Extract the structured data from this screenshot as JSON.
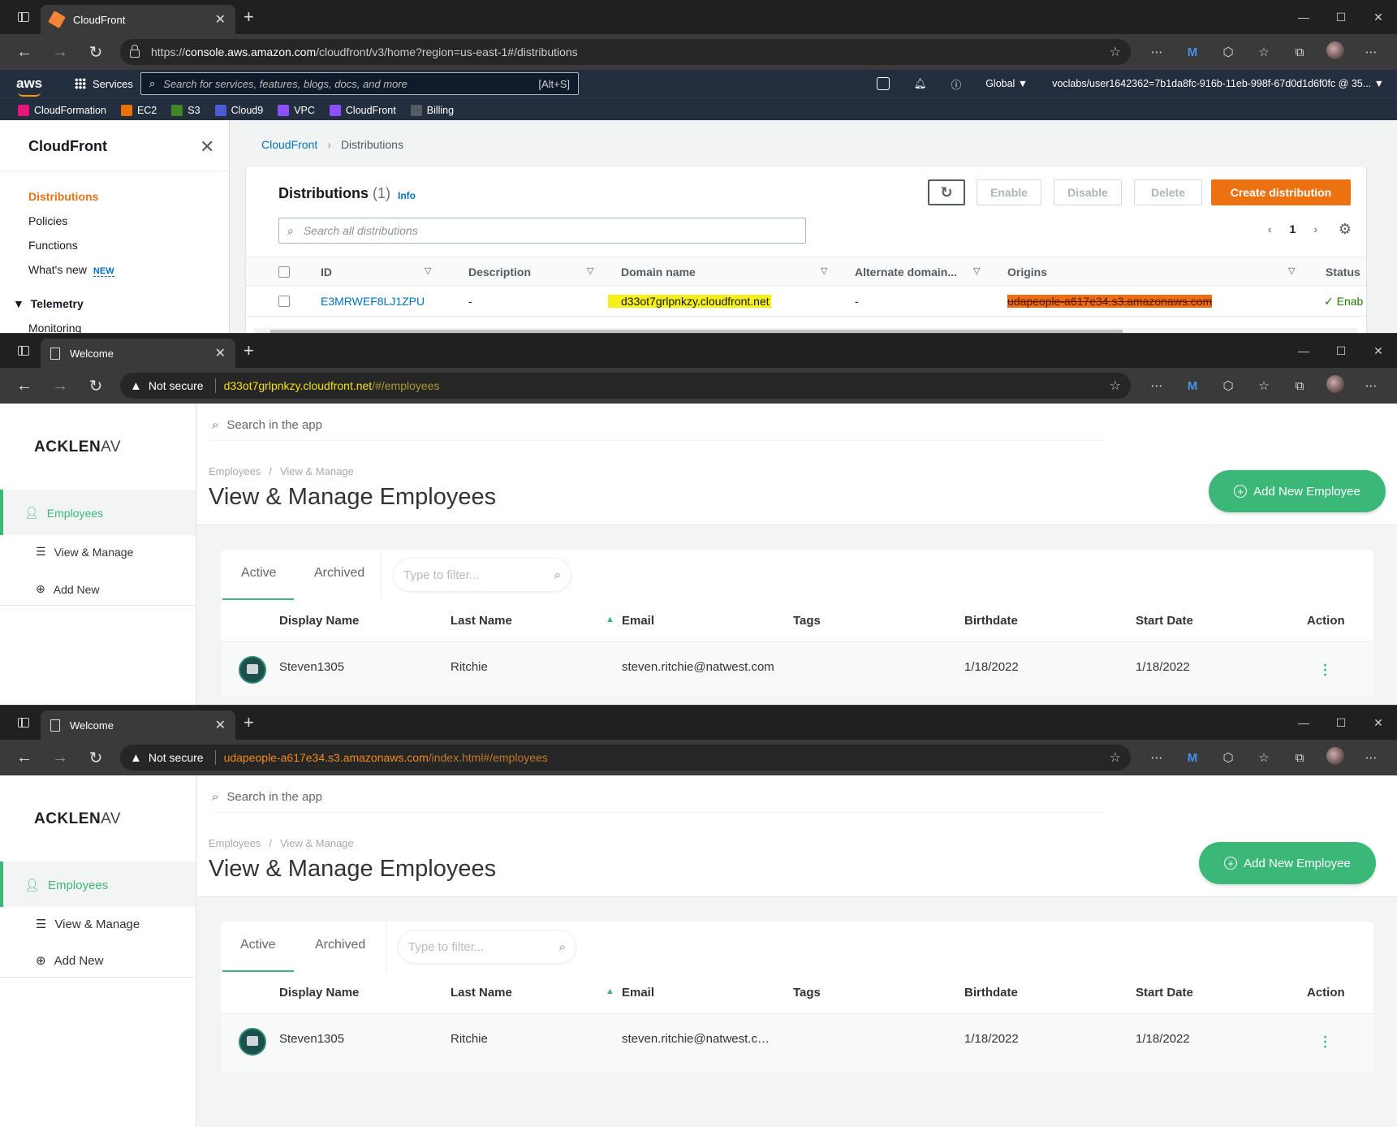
{
  "w1": {
    "tab_title": "CloudFront",
    "url_prefix": "https://",
    "url_host": "console.aws.amazon.com",
    "url_path": "/cloudfront/v3/home?region=us-east-1#/distributions",
    "aws": {
      "logo": "aws",
      "services": "Services",
      "search_placeholder": "Search for services, features, blogs, docs, and more",
      "shortcut": "[Alt+S]",
      "region": "Global ▼",
      "account": "voclabs/user1642362=7b1da8fc-916b-11eb-998f-67d0d1d6f0fc @ 35... ▼"
    },
    "favorites": [
      {
        "label": "CloudFormation",
        "color": "#e7157b"
      },
      {
        "label": "EC2",
        "color": "#ed7100"
      },
      {
        "label": "S3",
        "color": "#3f8624"
      },
      {
        "label": "Cloud9",
        "color": "#4d5bd9"
      },
      {
        "label": "VPC",
        "color": "#8c4fff"
      },
      {
        "label": "CloudFront",
        "color": "#8c4fff"
      },
      {
        "label": "Billing",
        "color": "#545b64"
      }
    ],
    "sidebar": {
      "title": "CloudFront",
      "items": [
        "Distributions",
        "Policies",
        "Functions",
        "What's new"
      ],
      "new_badge": "NEW",
      "telemetry": "Telemetry",
      "monitoring": "Monitoring"
    },
    "breadcrumb": [
      "CloudFront",
      "Distributions"
    ],
    "panel": {
      "title": "Distributions",
      "count": "(1)",
      "info": "Info",
      "buttons": {
        "enable": "Enable",
        "disable": "Disable",
        "delete": "Delete",
        "create": "Create distribution"
      },
      "search_placeholder": "Search all distributions",
      "page": "1",
      "columns": [
        "ID",
        "Description",
        "Domain name",
        "Alternate domain...",
        "Origins",
        "Status"
      ],
      "row": {
        "id": "E3MRWEF8LJ1ZPU",
        "description": "-",
        "domain": "d33ot7grlpnkzy.cloudfront.net",
        "alternate": "-",
        "origin": "udapeople-a617e34.s3.amazonaws.com",
        "status": "Enab"
      }
    }
  },
  "w2": {
    "tab_title": "Welcome",
    "not_secure": "Not secure",
    "url_host": "d33ot7grlpnkzy.cloudfront.net",
    "url_path": "/#/employees"
  },
  "w3": {
    "tab_title": "Welcome",
    "not_secure": "Not secure",
    "url_host": "udapeople-a617e34.s3.amazonaws.com",
    "url_path": "/index.html#/employees"
  },
  "app": {
    "logo_main": "ACKLEN",
    "logo_tail": "AV",
    "search_placeholder": "Search in the app",
    "nav": {
      "employees": "Employees",
      "view_manage": "View & Manage",
      "add_new": "Add New"
    },
    "breadcrumb": [
      "Employees",
      "View & Manage"
    ],
    "title": "View & Manage Employees",
    "add_button": "Add New Employee",
    "tabs": [
      "Active",
      "Archived"
    ],
    "filter_placeholder": "Type to filter...",
    "columns": [
      "Display Name",
      "Last Name",
      "Email",
      "Tags",
      "Birthdate",
      "Start Date",
      "Action"
    ],
    "row": {
      "display_name": "Steven1305",
      "last_name": "Ritchie",
      "email_full": "steven.ritchie@natwest.com",
      "email_trunc": "steven.ritchie@natwest.c…",
      "tags": "",
      "birthdate": "1/18/2022",
      "start_date": "1/18/2022"
    }
  }
}
